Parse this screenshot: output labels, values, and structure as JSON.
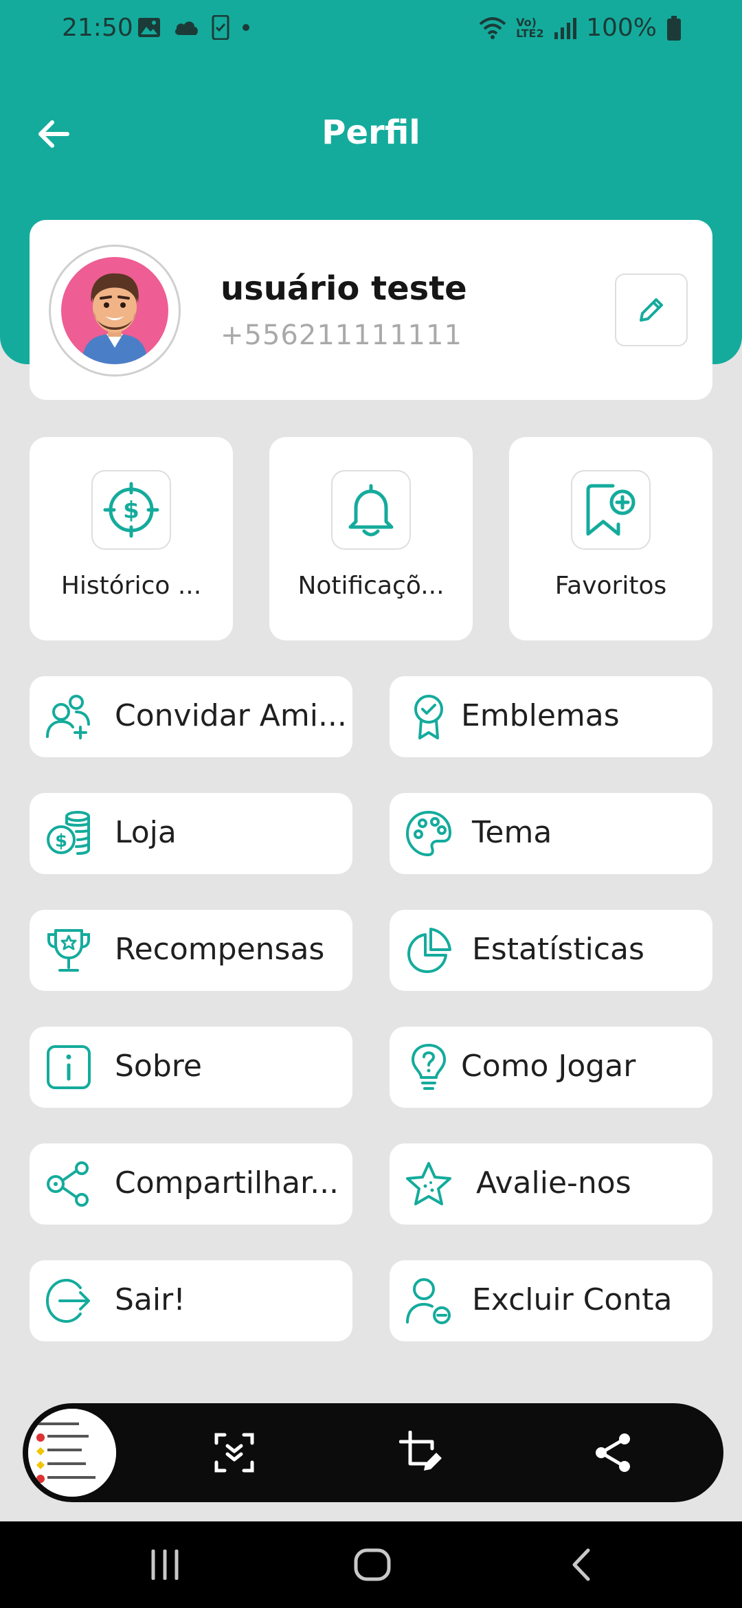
{
  "status_bar": {
    "time": "21:50",
    "battery": "100%",
    "network": "Vo) LTE2"
  },
  "header": {
    "title": "Perfil"
  },
  "profile": {
    "name": "usuário teste",
    "phone": "+556211111111"
  },
  "tiles": [
    {
      "label": "Histórico ...",
      "icon": "dollar-target-icon"
    },
    {
      "label": "Notificaçõ...",
      "icon": "bell-icon"
    },
    {
      "label": "Favoritos",
      "icon": "bookmark-plus-icon"
    }
  ],
  "menu": {
    "invite": "Convidar Ami...",
    "badges": "Emblemas",
    "store": "Loja",
    "theme": "Tema",
    "rewards": "Recompensas",
    "stats": "Estatísticas",
    "about": "Sobre",
    "how_to_play": "Como Jogar",
    "share": "Compartilhar...",
    "rate": "Avalie-nos",
    "logout": "Sair!",
    "delete_account": "Excluir Conta"
  },
  "colors": {
    "accent": "#14ab9c",
    "background": "#e4e4e4",
    "card": "#ffffff"
  }
}
